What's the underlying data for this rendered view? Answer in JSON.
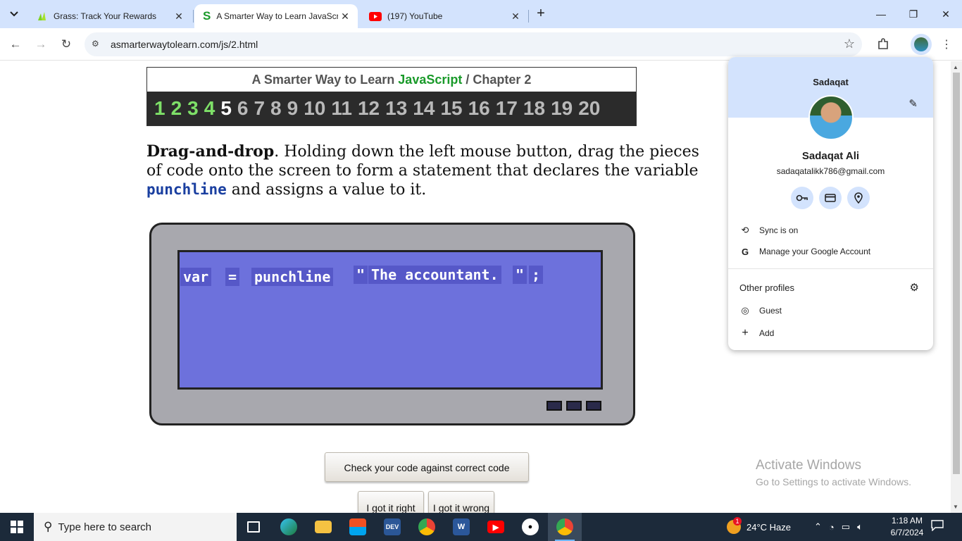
{
  "browser": {
    "tabs": [
      {
        "title": "Grass: Track Your Rewards",
        "active": false
      },
      {
        "title": "A Smarter Way to Learn JavaScript",
        "active": true
      },
      {
        "title": "(197) YouTube",
        "active": false
      }
    ],
    "url": "asmarterwaytolearn.com/js/2.html"
  },
  "page": {
    "title_prefix": "A Smarter Way to Learn",
    "title_js": "JavaScript",
    "title_sep": "/",
    "title_chapter": "Chapter 2",
    "chapters": [
      "1",
      "2",
      "3",
      "4",
      "5",
      "6",
      "7",
      "8",
      "9",
      "10",
      "11",
      "12",
      "13",
      "14",
      "15",
      "16",
      "17",
      "18",
      "19",
      "20"
    ],
    "current_chapter": "5",
    "instruction_bold": "Drag-and-drop",
    "instruction_text": ". Holding down the left mouse button, drag the pieces of code onto the screen to form a statement that declares the variable ",
    "instruction_code": "punchline",
    "instruction_tail": " and assigns a value to it.",
    "pieces": [
      "var",
      "=",
      "punchline",
      "\"",
      "The accountant.",
      "\"",
      ";"
    ],
    "check_button": "Check your code against correct code",
    "right_button": "I got it right",
    "wrong_button": "I got it wrong",
    "activate_title": "Activate Windows",
    "activate_sub": "Go to Settings to activate Windows."
  },
  "profile": {
    "header_name": "Sadaqat",
    "full_name": "Sadaqat Ali",
    "email": "sadaqatalikk786@gmail.com",
    "sync": "Sync is on",
    "manage": "Manage your Google Account",
    "other_profiles": "Other profiles",
    "guest": "Guest",
    "add": "Add"
  },
  "taskbar": {
    "search_placeholder": "Type here to search",
    "weather": "24°C  Haze",
    "time": "1:18 AM",
    "date": "6/7/2024",
    "weather_badge": "1"
  },
  "colors": {
    "accent": "#d3e3fd",
    "js_green": "#1a9a2a",
    "lcd": "#6d71dc"
  }
}
